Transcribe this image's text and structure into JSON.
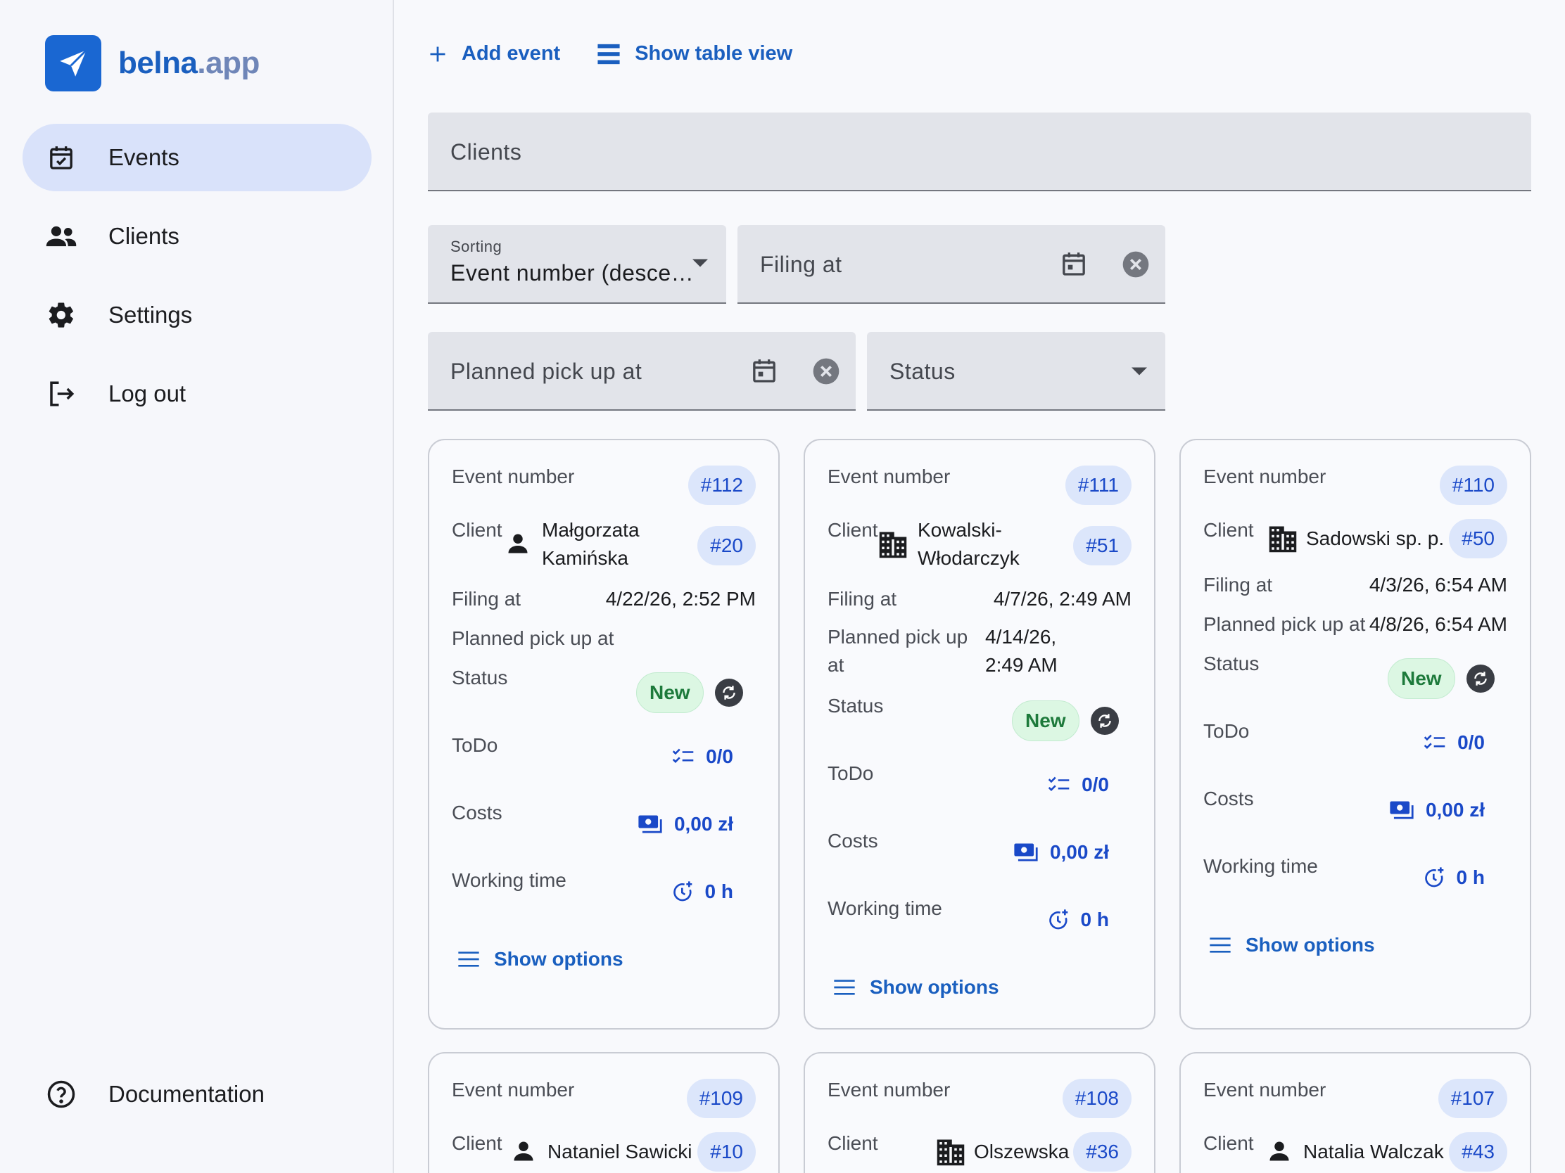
{
  "brand": {
    "name": "belna",
    "suffix": ".app",
    "color": "#1a67d2"
  },
  "sidebar": {
    "items": [
      {
        "label": "Events",
        "icon": "calendar-check-icon"
      },
      {
        "label": "Clients",
        "icon": "people-icon"
      },
      {
        "label": "Settings",
        "icon": "gear-icon"
      },
      {
        "label": "Log out",
        "icon": "logout-icon"
      }
    ],
    "bottom": {
      "label": "Documentation",
      "icon": "help-circle-icon"
    }
  },
  "toolbar": {
    "add_event": "Add event",
    "table_view": "Show table view"
  },
  "filters": {
    "clients_placeholder": "Clients",
    "sorting_label": "Sorting",
    "sorting_value": "Event number (desce…",
    "filing_at_placeholder": "Filing at",
    "planned_pickup_placeholder": "Planned pick up at",
    "status_placeholder": "Status"
  },
  "labels": {
    "event_number": "Event number",
    "client": "Client",
    "filing_at": "Filing at",
    "planned_pickup_at": "Planned pick up at",
    "planned_pickup_line1": "Planned pick up",
    "planned_pickup_line2": "at",
    "status": "Status",
    "todo": "ToDo",
    "costs": "Costs",
    "working_time": "Working time",
    "show_options": "Show options"
  },
  "cards": [
    {
      "number": "#112",
      "client_type": "person",
      "client_name_1": "Małgorzata",
      "client_name_2": "Kamińska",
      "client_id": "#20",
      "filing_at": "4/22/26, 2:52 PM",
      "planned_pickup": "",
      "status": "New",
      "todo": "0/0",
      "costs": "0,00 zł",
      "working_time": "0 h"
    },
    {
      "number": "#111",
      "client_type": "company",
      "client_name_1": "Kowalski-",
      "client_name_2": "Włodarczyk",
      "client_id": "#51",
      "filing_at": "4/7/26, 2:49 AM",
      "planned_pickup_1": "4/14/26,",
      "planned_pickup_2": "2:49 AM",
      "status": "New",
      "todo": "0/0",
      "costs": "0,00 zł",
      "working_time": "0 h"
    },
    {
      "number": "#110",
      "client_type": "company",
      "client_name_1": "Sadowski sp. p.",
      "client_id": "#50",
      "filing_at": "4/3/26, 6:54 AM",
      "planned_pickup": "4/8/26, 6:54 AM",
      "status": "New",
      "todo": "0/0",
      "costs": "0,00 zł",
      "working_time": "0 h"
    },
    {
      "number": "#109",
      "client_type": "person",
      "client_name_1": "Nataniel Sawicki",
      "client_id": "#10"
    },
    {
      "number": "#108",
      "client_type": "company",
      "client_name_1": "Olszewska",
      "client_id": "#36"
    },
    {
      "number": "#107",
      "client_type": "person",
      "client_name_1": "Natalia Walczak",
      "client_id": "#43"
    }
  ]
}
